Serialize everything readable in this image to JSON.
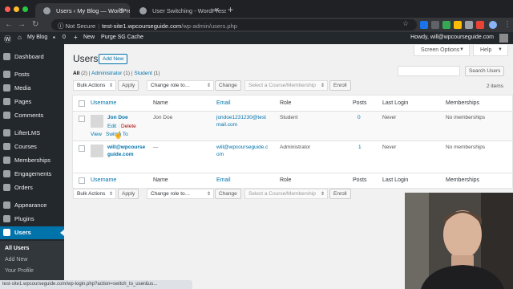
{
  "browser": {
    "tabs": [
      {
        "title": "Users ‹ My Blog — WordPress",
        "active": true
      },
      {
        "title": "User Switching - WordPress p",
        "active": false
      }
    ],
    "omnibox": {
      "security": "Not Secure",
      "host": "test-site1.wpcourseguide.com",
      "path": "/wp-admin/users.php"
    },
    "status_url": "test-site1.wpcourseguide.com/wp-login.php?action=switch_to_user&us..."
  },
  "admin_bar": {
    "site_name": "My Blog",
    "comments_count": "0",
    "new_label": "New",
    "purge_label": "Purge SG Cache",
    "howdy": "Howdy, will@wpcourseguide.com"
  },
  "sidebar": {
    "items": [
      {
        "label": "Dashboard"
      },
      {
        "label": "Posts"
      },
      {
        "label": "Media"
      },
      {
        "label": "Pages"
      },
      {
        "label": "Comments"
      },
      {
        "label": "LifterLMS"
      },
      {
        "label": "Courses"
      },
      {
        "label": "Memberships"
      },
      {
        "label": "Engagements"
      },
      {
        "label": "Orders"
      },
      {
        "label": "Appearance"
      },
      {
        "label": "Plugins"
      },
      {
        "label": "Users"
      }
    ],
    "submenu": [
      {
        "label": "All Users"
      },
      {
        "label": "Add New"
      },
      {
        "label": "Your Profile"
      }
    ]
  },
  "screen_options": {
    "screen_options_label": "Screen Options",
    "help_label": "Help"
  },
  "page": {
    "title": "Users",
    "add_new_label": "Add New",
    "filters": {
      "all": "All",
      "all_count": "(2)",
      "admin": "Administrator",
      "admin_count": "(1)",
      "student": "Student",
      "student_count": "(1)"
    },
    "search_button": "Search Users",
    "items_count": "2 items"
  },
  "bulk": {
    "bulk_actions": "Bulk Actions",
    "apply": "Apply",
    "change_role": "Change role to…",
    "change": "Change",
    "course_select": "Select a Course/Membership",
    "enroll": "Enroll"
  },
  "table": {
    "columns": {
      "username": "Username",
      "name": "Name",
      "email": "Email",
      "role": "Role",
      "posts": "Posts",
      "last_login": "Last Login",
      "memberships": "Memberships"
    },
    "rows": [
      {
        "username": "Jon Doe",
        "name": "Jon Doe",
        "email_line1": "jondoe1231230@test",
        "email_line2": "mail.com",
        "role": "Student",
        "posts": "0",
        "last_login": "Never",
        "memberships": "No memberships",
        "actions": {
          "edit": "Edit",
          "sep": "|",
          "delete": "Delete",
          "view": "View",
          "switch_to": "Switch To"
        }
      },
      {
        "username_line1": "will@wpcourse",
        "username_line2": "guide.com",
        "name": "—",
        "email_line1": "will@wpcourseguide.c",
        "email_line2": "om",
        "role": "Administrator",
        "posts": "1",
        "last_login": "Never",
        "memberships": "No memberships"
      }
    ]
  }
}
